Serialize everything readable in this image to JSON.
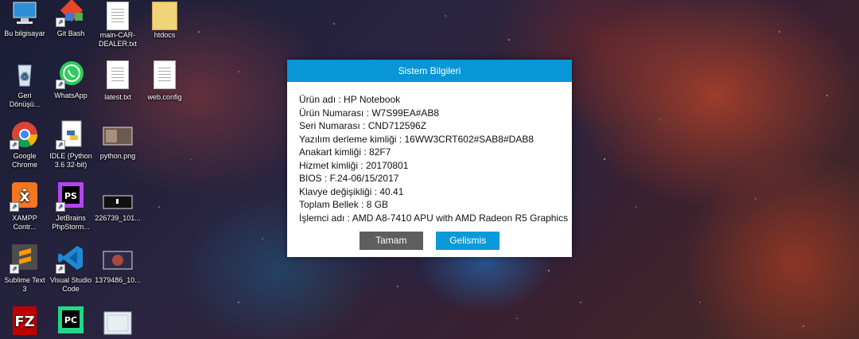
{
  "desktop_icons": [
    {
      "label": "Bu bilgisayar",
      "icon": "computer-icon"
    },
    {
      "label": "Git Bash",
      "icon": "git-icon"
    },
    {
      "label": "main-CAR-\nDEALER.txt",
      "icon": "text-file-icon"
    },
    {
      "label": "htdocs",
      "icon": "folder-icon"
    },
    {
      "label": "Geri\nDönüşü...",
      "icon": "recycle-bin-icon"
    },
    {
      "label": "WhatsApp",
      "icon": "whatsapp-icon"
    },
    {
      "label": "latest.txt",
      "icon": "text-file-icon"
    },
    {
      "label": "web.config",
      "icon": "file-icon"
    },
    {
      "label": "Google\nChrome",
      "icon": "chrome-icon"
    },
    {
      "label": "IDLE (Python\n3.6 32-bit)",
      "icon": "python-idle-icon"
    },
    {
      "label": "python.png",
      "icon": "image-file-icon"
    },
    {
      "label": "XAMPP\nContr...",
      "icon": "xampp-icon"
    },
    {
      "label": "JetBrains\nPhpStorm...",
      "icon": "phpstorm-icon"
    },
    {
      "label": "226739_101...",
      "icon": "image-file-icon"
    },
    {
      "label": "Sublime Text\n3",
      "icon": "sublime-icon"
    },
    {
      "label": "Visual Studio\nCode",
      "icon": "vscode-icon"
    },
    {
      "label": "1379486_10...",
      "icon": "image-file-icon"
    },
    {
      "label": "",
      "icon": "filezilla-icon"
    },
    {
      "label": "",
      "icon": "pycharm-icon"
    },
    {
      "label": "",
      "icon": "image-file-icon"
    }
  ],
  "dialog": {
    "title": "Sistem Bilgileri",
    "lines": [
      "Ürün adı : HP Notebook",
      "Ürün Numarası : W7S99EA#AB8",
      "Seri Numarası : CND712596Z",
      "Yazılım derleme kimliği : 16WW3CRT602#SAB8#DAB8",
      "Anakart kimliği : 82F7",
      "Hizmet kimliği : 20170801",
      "BIOS : F.24-06/15/2017",
      "Klavye değişikliği : 40.41",
      "Toplam Bellek : 8 GB",
      "İşlemci adı : AMD A8-7410 APU with AMD Radeon R5 Graphics"
    ],
    "ok_label": "Tamam",
    "advanced_label": "Gelismis"
  },
  "colors": {
    "title_bar": "#0996d6",
    "ok_button": "#5e5e5e",
    "advanced_button": "#0a9ad9"
  }
}
